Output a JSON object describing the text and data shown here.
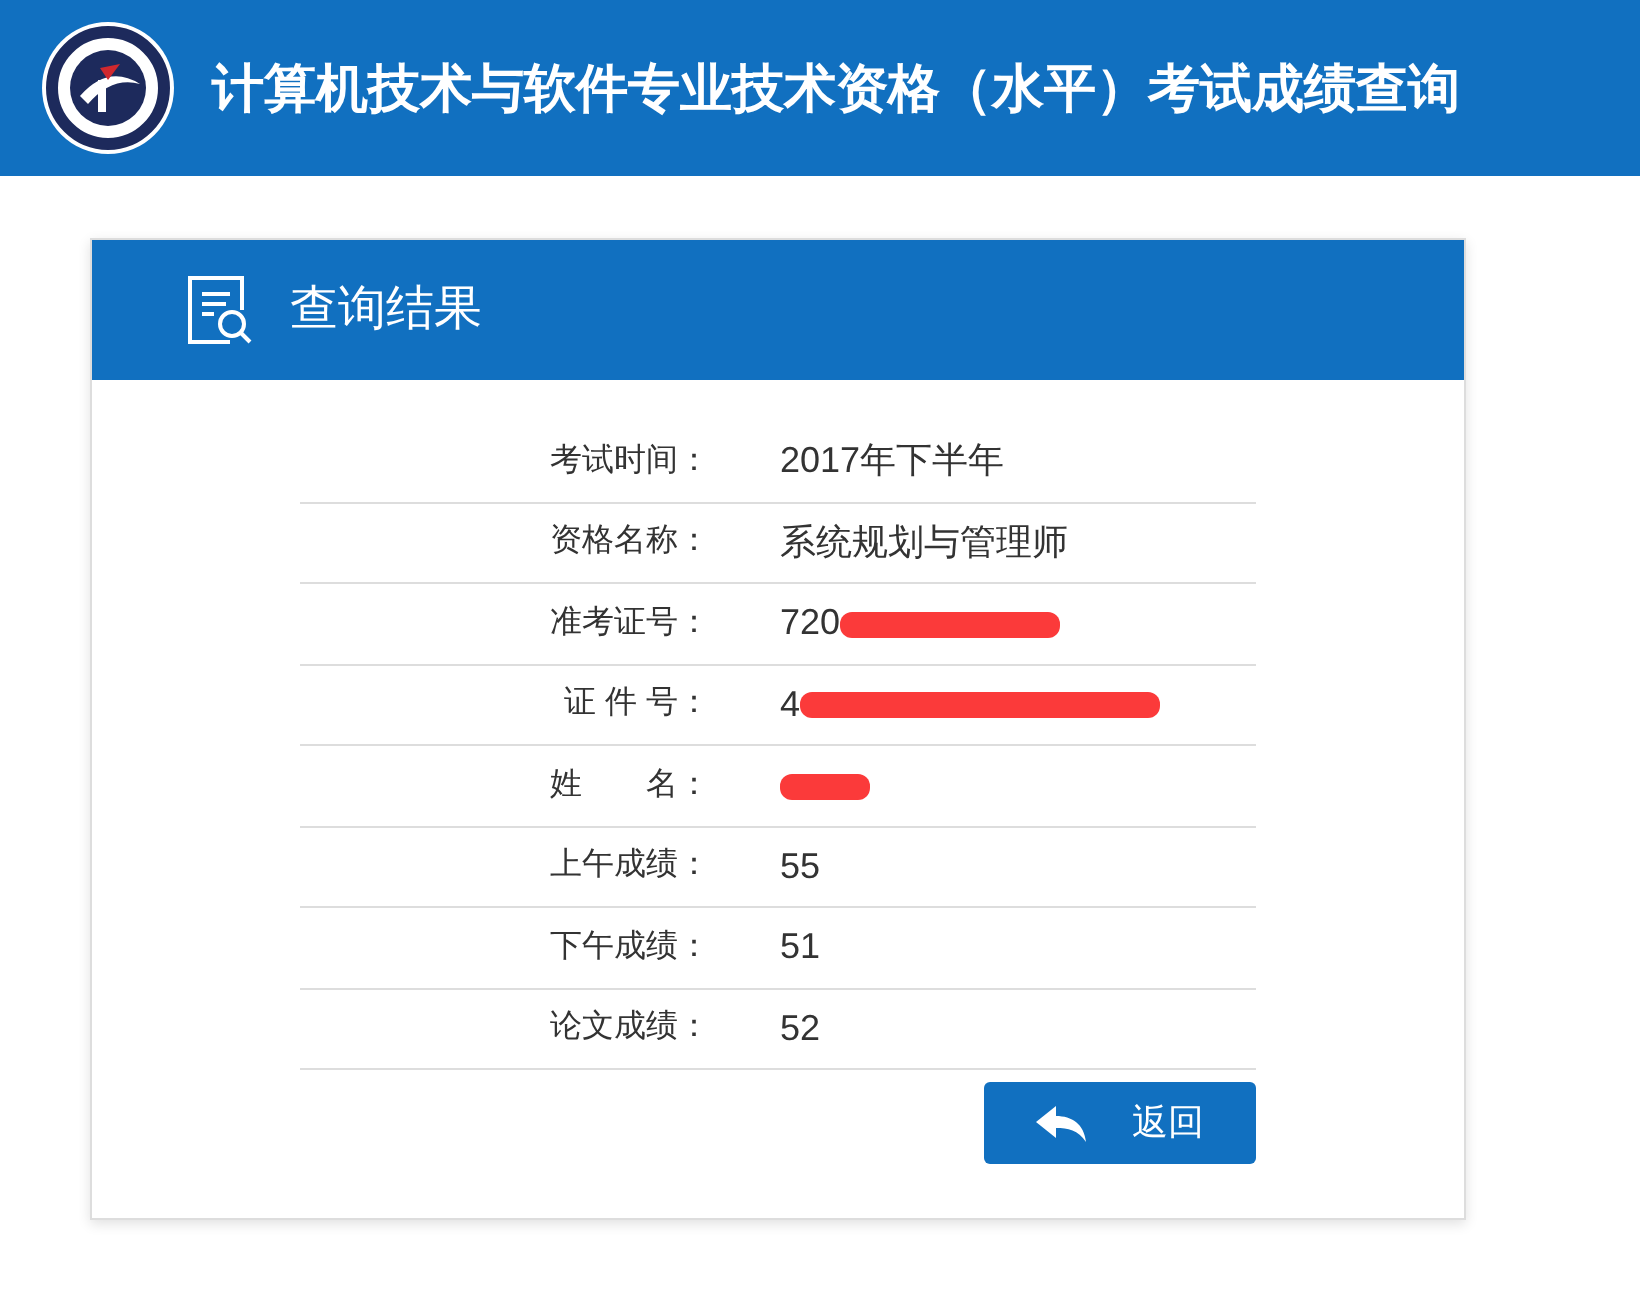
{
  "header": {
    "title": "计算机技术与软件专业技术资格（水平）考试成绩查询"
  },
  "card": {
    "title": "查询结果",
    "rows": [
      {
        "label": "考试时间：",
        "value": "2017年下半年",
        "redacted": false
      },
      {
        "label": "资格名称：",
        "value": "系统规划与管理师",
        "redacted": false
      },
      {
        "label": "准考证号：",
        "value": "720",
        "redacted": true
      },
      {
        "label": "证 件 号：",
        "value": "4",
        "redacted": true
      },
      {
        "label": "姓　　名：",
        "redacted": true
      },
      {
        "label": "上午成绩：",
        "value": "55",
        "redacted": false
      },
      {
        "label": "下午成绩：",
        "value": "51",
        "redacted": false
      },
      {
        "label": "论文成绩：",
        "value": "52",
        "redacted": false
      }
    ],
    "back_button": "返回"
  }
}
